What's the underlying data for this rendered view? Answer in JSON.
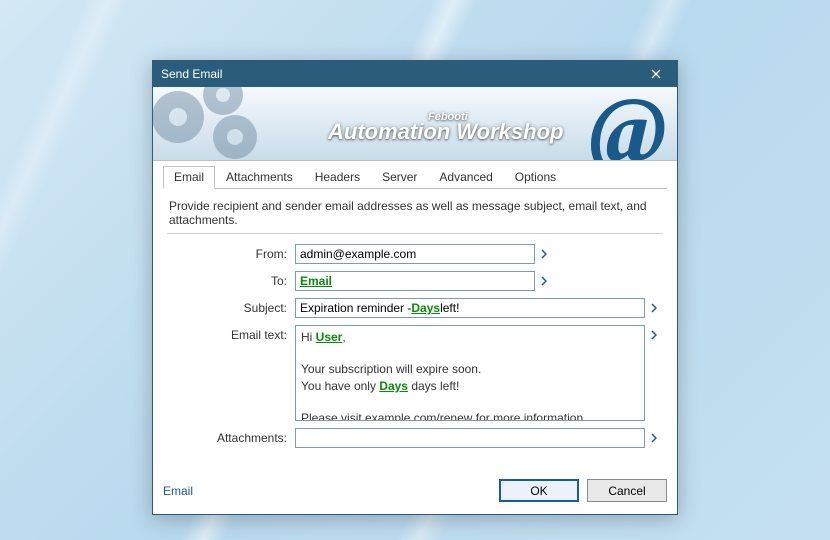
{
  "window": {
    "title": "Send Email",
    "brand_small": "Febooti",
    "brand_big": "Automation Workshop"
  },
  "tabs": [
    "Email",
    "Attachments",
    "Headers",
    "Server",
    "Advanced",
    "Options"
  ],
  "active_tab": 0,
  "intro": "Provide recipient and sender email addresses as well as message subject, email text, and attachments.",
  "labels": {
    "from": "From:",
    "to": "To:",
    "subject": "Subject:",
    "email_text": "Email text:",
    "attachments": "Attachments:"
  },
  "fields": {
    "from": "admin@example.com",
    "to_var": "Email",
    "subject_prefix": "Expiration reminder - ",
    "subject_var": "Days",
    "subject_suffix": " left!",
    "body": {
      "greeting_prefix": "Hi ",
      "greeting_var": "User",
      "greeting_suffix": ",",
      "line2": "Your subscription will expire soon.",
      "line3_prefix": "You have only ",
      "line3_var": "Days",
      "line3_suffix": " days left!",
      "line4": "Please visit example.com/renew for more information."
    },
    "attachments": ""
  },
  "footer": {
    "help_link": "Email",
    "ok": "OK",
    "cancel": "Cancel"
  }
}
